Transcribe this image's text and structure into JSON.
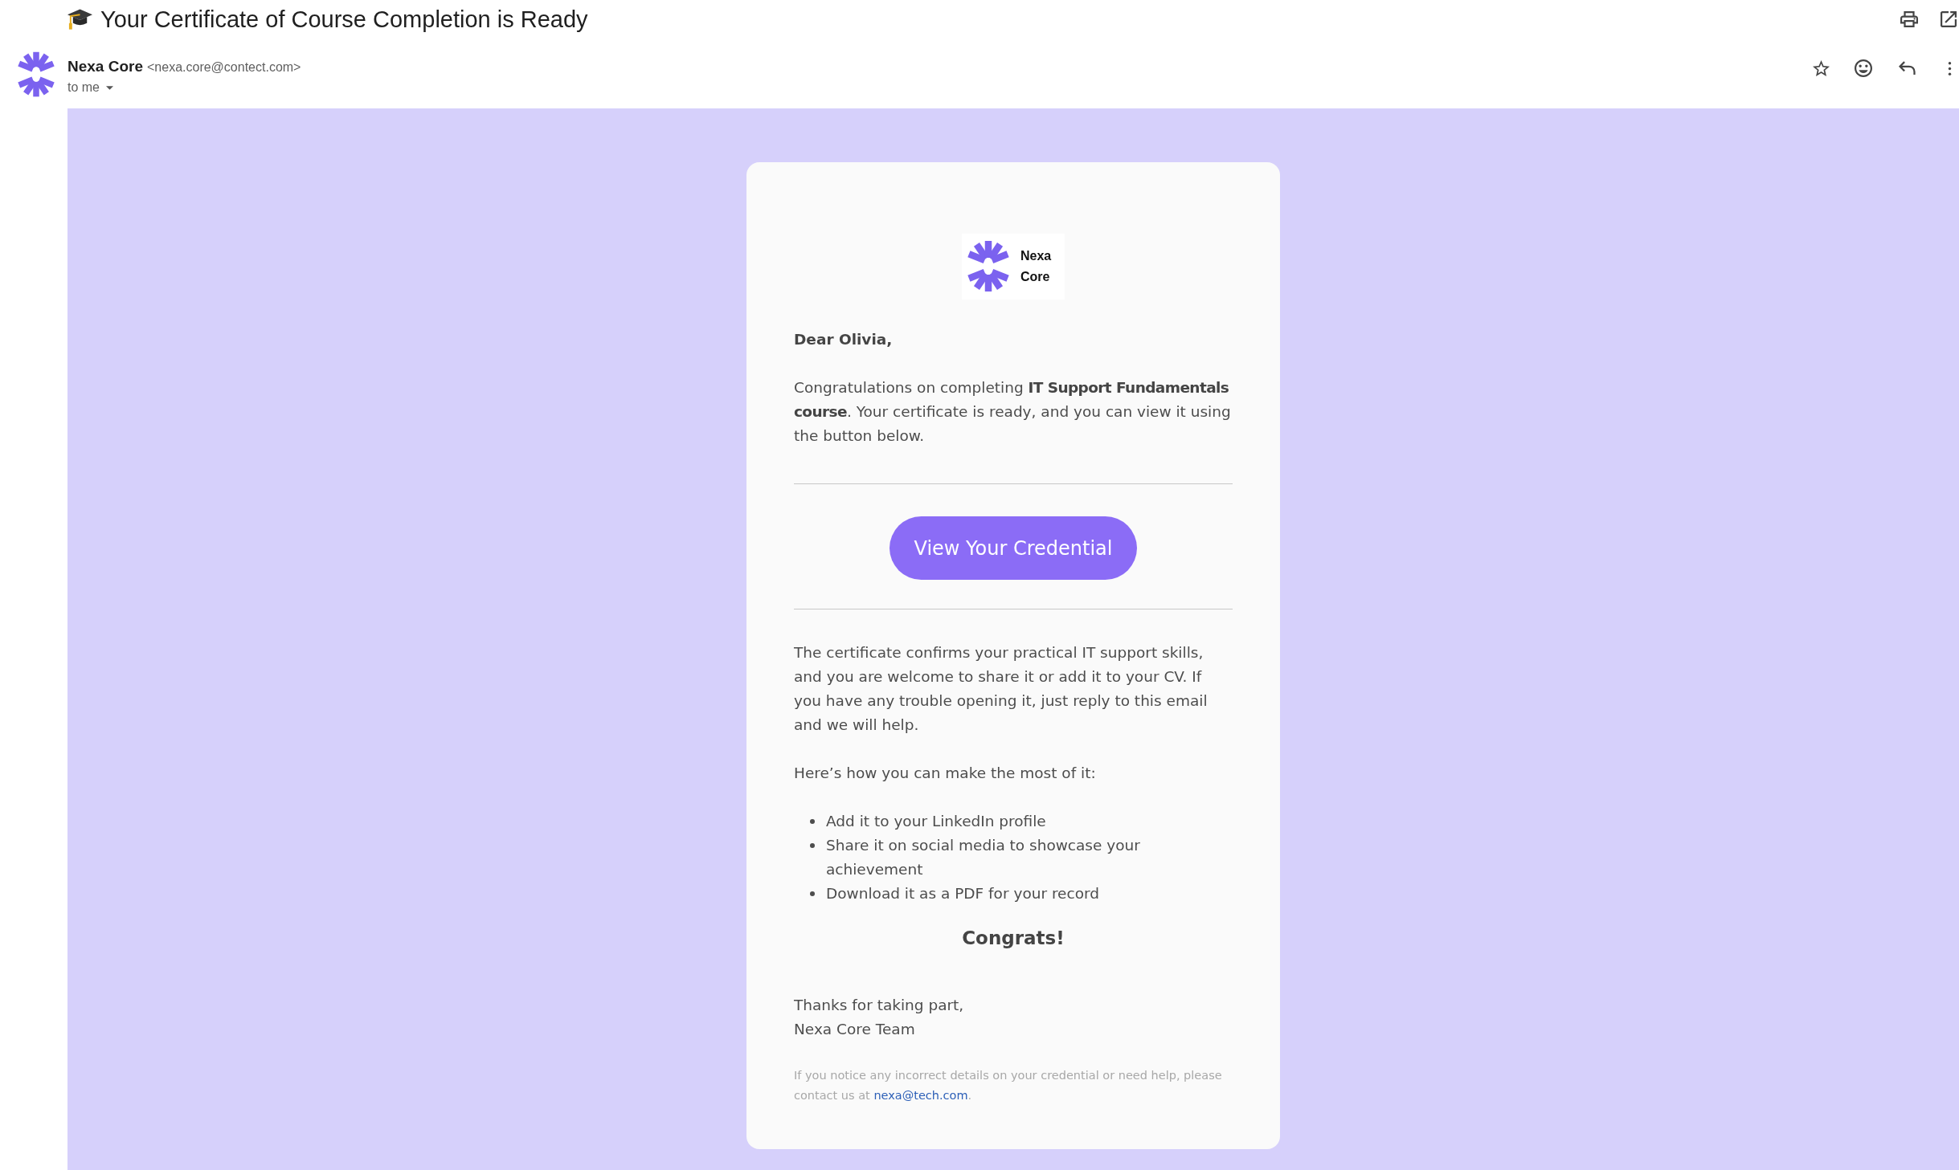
{
  "email": {
    "subject": "Your Certificate of Course Completion is Ready",
    "starred": false
  },
  "sender": {
    "name": "Nexa Core",
    "address": "<nexa.core@contect.com>",
    "recipient": "to me"
  },
  "message": {
    "logo": {
      "lines": [
        "Nexa",
        "Core"
      ]
    },
    "greeting": "Dear Olivia,",
    "intro": "Congratulations on completing **IT Support Fundamentals course**. Your certificate is ready, and you can view it using the button below.",
    "button": "View Your Credential",
    "body": "The certificate confirms your practical IT support skills, and you are welcome to share it or add it to your CV. If you have any trouble opening it, just reply to this email and we will help.",
    "list_intro": "Here’s how you can make the most of it:",
    "tips": [
      "Add it to your LinkedIn profile",
      "Share it on social media to showcase your achievement",
      "Download it as a PDF for your record"
    ],
    "congrats": "Congrats!",
    "signoff": [
      "Thanks for taking part,",
      "Nexa Core Team"
    ],
    "footer_note": {
      "text": "If you notice any incorrect details on your credential or need help, please contact us at",
      "link": "nexa@tech.com",
      "after": "."
    }
  }
}
